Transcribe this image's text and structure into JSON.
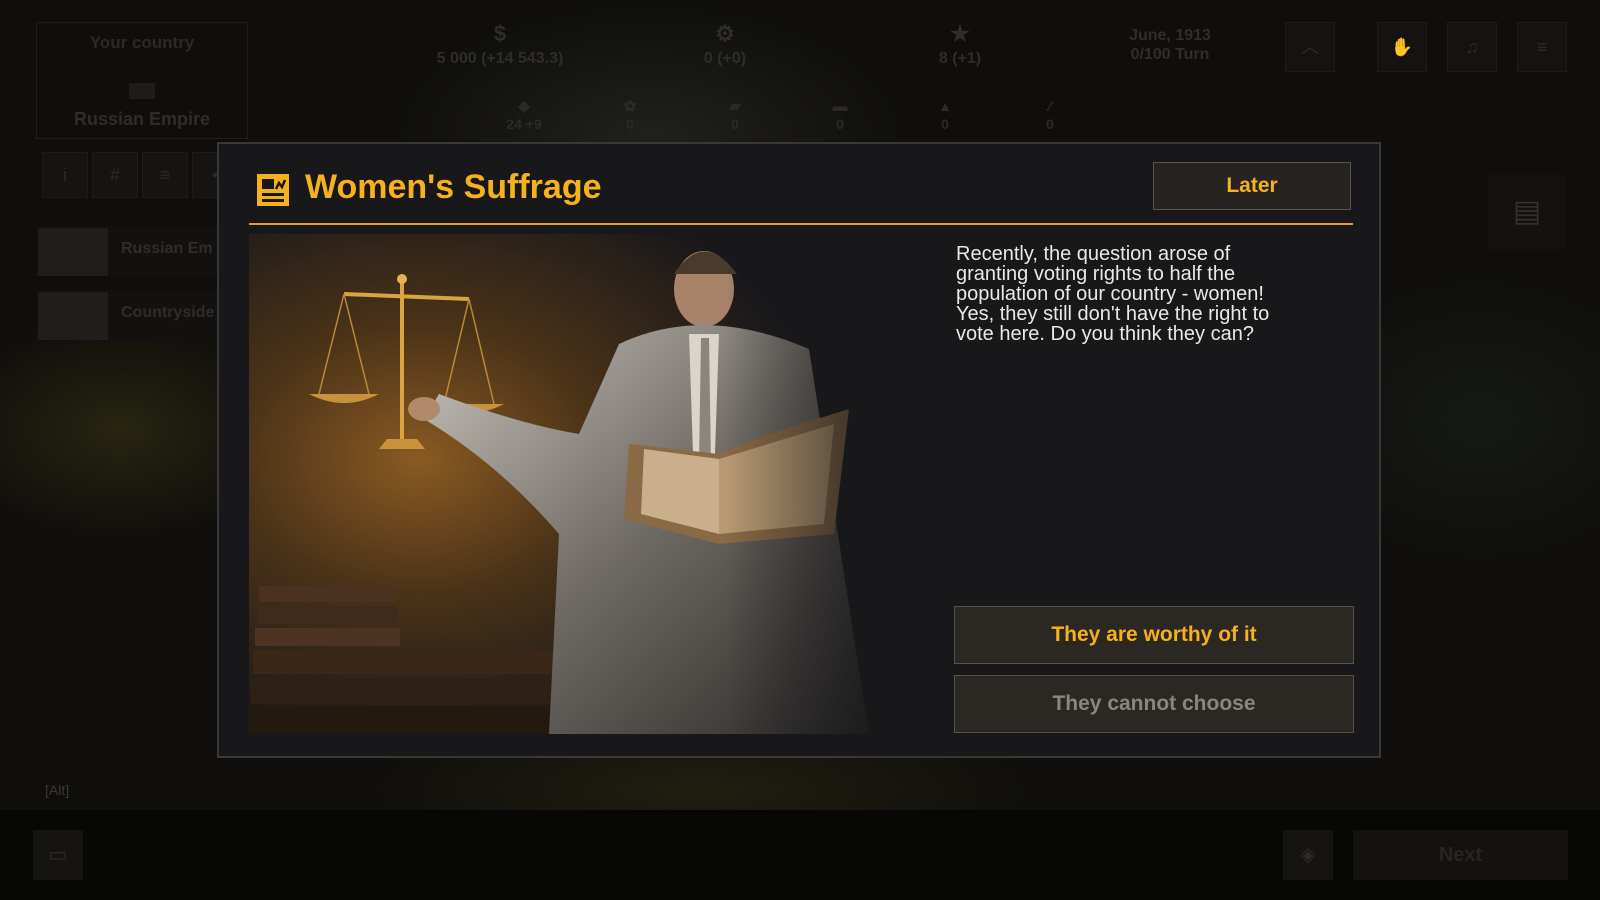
{
  "top_bar": {
    "your_country_label": "Your country",
    "country_name": "Russian Empire",
    "money": "5 000 (+14 543.3)",
    "influence": "0 (+0)",
    "prestige": "8 (+1)",
    "date": "June, 1913",
    "turn": "0/100 Turn",
    "resources": [
      "24 +9",
      "0",
      "0",
      "0",
      "0",
      "0"
    ]
  },
  "sidebar": {
    "rows": [
      {
        "label": "Russian Em"
      },
      {
        "label": "Countryside"
      }
    ]
  },
  "bottom": {
    "alt_hint": "[Alt]",
    "next_label": "Next"
  },
  "event": {
    "title": "Women's Suffrage",
    "later_label": "Later",
    "description": "Recently, the question arose of\ngranting voting rights to half the\npopulation of our country - women!\nYes, they still don't have the right to\nvote here. Do you think they can?",
    "options": [
      {
        "label": "They are worthy of it"
      },
      {
        "label": "They cannot choose"
      }
    ]
  },
  "colors": {
    "accent": "#f5b21e",
    "modal_bg": "#18171a",
    "button_bg": "#2b2723",
    "disabled_text": "#8c857b"
  },
  "icons": {
    "event_icon": "newspaper-icon",
    "money_icon": "dollar-icon",
    "influence_icon": "gear-icon",
    "prestige_icon": "star-icon"
  }
}
